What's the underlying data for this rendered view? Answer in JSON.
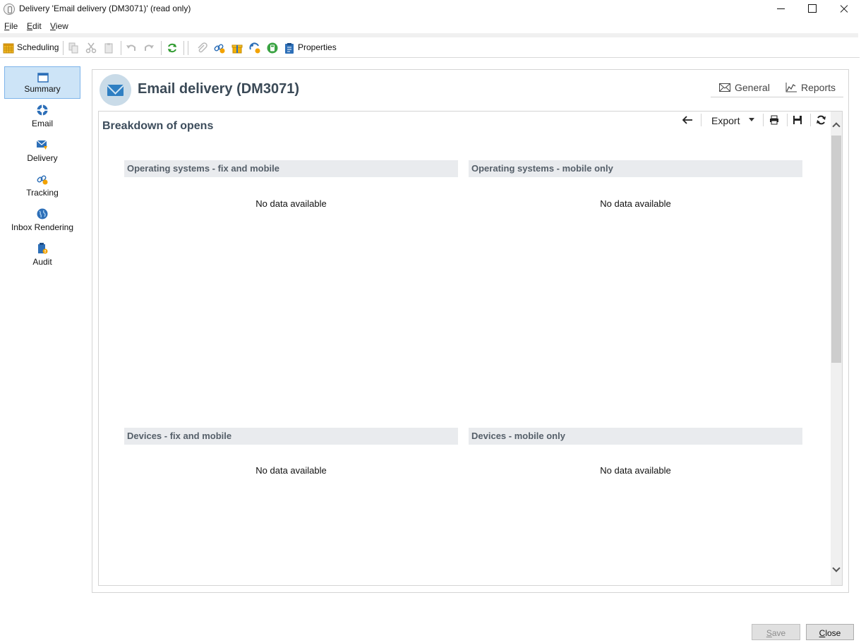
{
  "window": {
    "title": "Delivery 'Email delivery (DM3071)' (read only)"
  },
  "menu": [
    "File",
    "Edit",
    "View"
  ],
  "toolbar": {
    "scheduling_label": "Scheduling",
    "properties_label": "Properties",
    "icons": [
      "calendar-icon",
      "copy-icon",
      "cut-icon",
      "paste-icon",
      "undo-icon",
      "redo-icon",
      "refresh-icon",
      "attachment-icon",
      "link-icon",
      "gift-icon",
      "personalization-icon",
      "calculator-icon",
      "clipboard-icon"
    ]
  },
  "sidebar": {
    "items": [
      {
        "label": "Summary",
        "icon": "summary-icon",
        "active": true
      },
      {
        "label": "Email",
        "icon": "email-icon",
        "active": false
      },
      {
        "label": "Delivery",
        "icon": "delivery-icon",
        "active": false
      },
      {
        "label": "Tracking",
        "icon": "tracking-icon",
        "active": false
      },
      {
        "label": "Inbox Rendering",
        "icon": "globe-icon",
        "active": false
      },
      {
        "label": "Audit",
        "icon": "audit-icon",
        "active": false
      }
    ]
  },
  "header": {
    "title": "Email delivery (DM3071)",
    "tabs": [
      {
        "label": "General",
        "icon": "envelope-icon"
      },
      {
        "label": "Reports",
        "icon": "chart-icon"
      }
    ]
  },
  "report": {
    "title": "Breakdown of opens",
    "toolbar": {
      "export_label": "Export"
    },
    "charts": [
      {
        "title": "Operating systems - fix and mobile",
        "message": "No data available"
      },
      {
        "title": "Operating systems - mobile only",
        "message": "No data available"
      },
      {
        "title": "Devices - fix and mobile",
        "message": "No data available"
      },
      {
        "title": "Devices - mobile only",
        "message": "No data available"
      }
    ]
  },
  "footer": {
    "save_label": "Save",
    "close_label": "Close"
  },
  "colors": {
    "accent": "#2f7fc2",
    "active_nav_bg": "#cde4f7",
    "heading": "#3b4a57",
    "chart_header_bg": "#e9ebee"
  }
}
